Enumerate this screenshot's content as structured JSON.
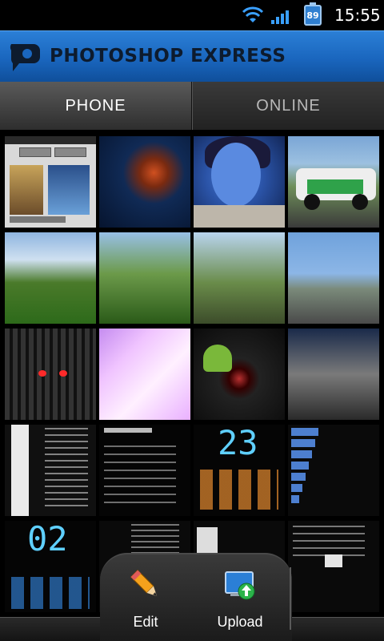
{
  "status_bar": {
    "wifi_icon": "wifi-icon",
    "signal_icon": "cell-signal-icon",
    "battery_level": "89",
    "time": "15:55"
  },
  "app_header": {
    "title": "PHOTOSHOP EXPRESS",
    "logo_icon": "photoshop-express-logo"
  },
  "tabs": [
    {
      "label": "PHONE",
      "active": true
    },
    {
      "label": "ONLINE",
      "active": false
    }
  ],
  "photo_grid": {
    "thumbnails": [
      {
        "id": 1,
        "text": ""
      },
      {
        "id": 2,
        "text": ""
      },
      {
        "id": 3,
        "text": ""
      },
      {
        "id": 4,
        "text": ""
      },
      {
        "id": 5,
        "text": ""
      },
      {
        "id": 6,
        "text": ""
      },
      {
        "id": 7,
        "text": ""
      },
      {
        "id": 8,
        "text": ""
      },
      {
        "id": 9,
        "text": ""
      },
      {
        "id": 10,
        "text": ""
      },
      {
        "id": 11,
        "text": ""
      },
      {
        "id": 12,
        "text": ""
      },
      {
        "id": 13,
        "text": ""
      },
      {
        "id": 14,
        "text": ""
      },
      {
        "id": 15,
        "text": "23"
      },
      {
        "id": 16,
        "text": ""
      },
      {
        "id": 17,
        "text": "02"
      },
      {
        "id": 18,
        "text": ""
      },
      {
        "id": 19,
        "text": ""
      },
      {
        "id": 20,
        "text": ""
      }
    ]
  },
  "action_bar": {
    "edit_label": "Edit",
    "upload_label": "Upload",
    "edit_icon": "pencil-icon",
    "upload_icon": "upload-icon"
  },
  "colors": {
    "header_blue": "#1a66be",
    "tab_active_bg": "#4a4a4a",
    "background": "#000000"
  }
}
